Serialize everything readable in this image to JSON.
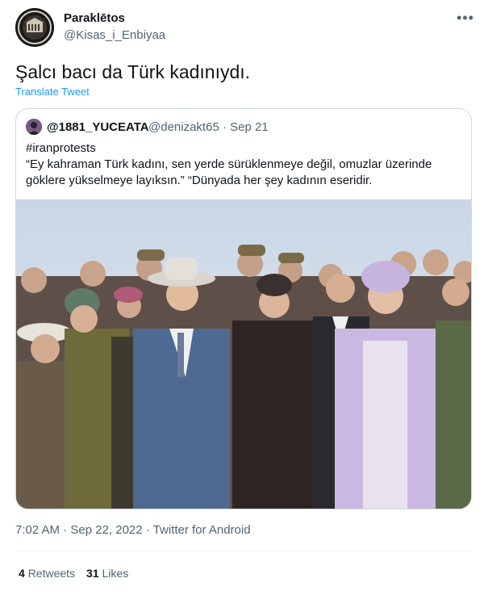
{
  "author": {
    "display_name": "Paraklētos",
    "handle": "@Kisas_i_Enbiyaa"
  },
  "menu": {
    "more_label": "•••"
  },
  "tweet": {
    "text": "Şalcı bacı da Türk kadınıydı.",
    "translate_label": "Translate Tweet"
  },
  "quote": {
    "author_name": "@1881_YUCEATA",
    "author_handle_date": "@denizakt65 · Sep 21",
    "lines": [
      "#iranprotests",
      "“Ey kahraman Türk kadını, sen yerde sürüklenmeye değil, omuzlar üzerinde",
      "göklere yükselmeye layıksın.” “Dünyada her şey kadının eseridir."
    ]
  },
  "meta": {
    "timestamp": "7:02 AM · Sep 22, 2022 · Twitter for Android"
  },
  "stats": {
    "retweets_count": "4",
    "retweets_label": "Retweets",
    "likes_count": "31",
    "likes_label": "Likes"
  },
  "colors": {
    "link": "#1d9bf0",
    "secondary_text": "#536471",
    "primary_text": "#0f1419",
    "border": "#cfd9de"
  }
}
